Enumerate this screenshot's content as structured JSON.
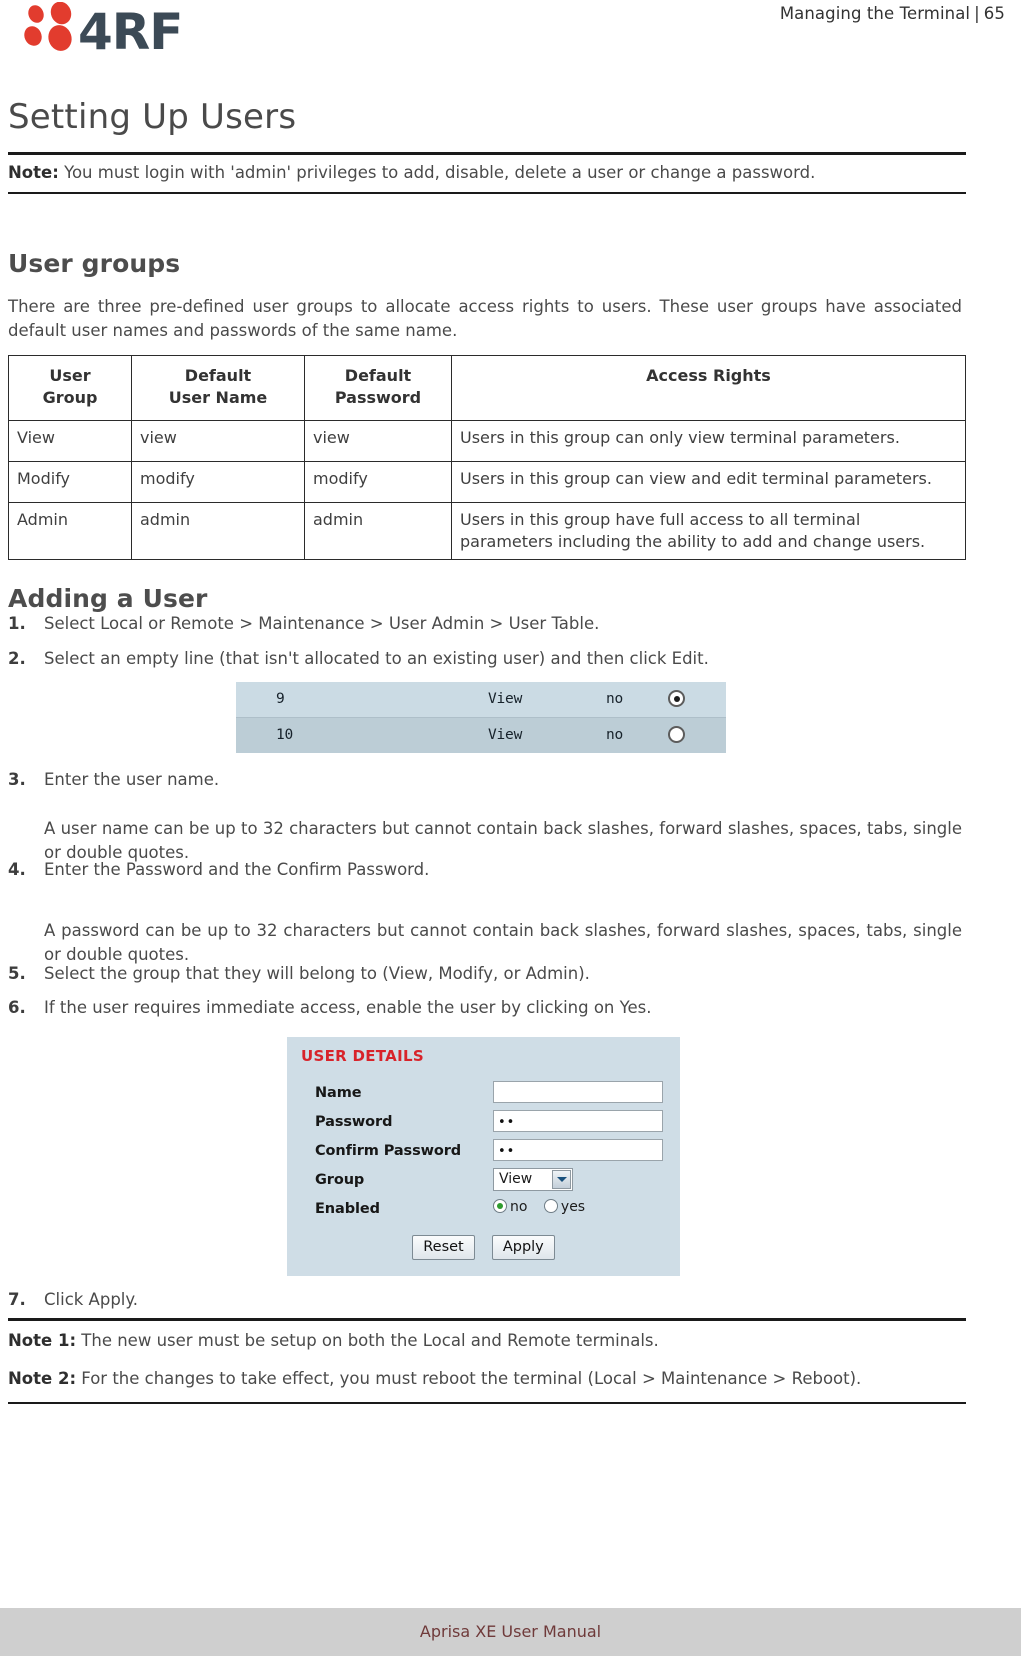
{
  "header": {
    "logo_alt": "4RF",
    "logo_text": "4RF",
    "breadcrumb_title": "Managing the Terminal",
    "breadcrumb_separator": "|",
    "page_number": "65"
  },
  "page_title": "Setting Up Users",
  "top_note": {
    "label": "Note:",
    "text": " You must login with 'admin' privileges to add, disable, delete a user or change a password."
  },
  "sections": {
    "user_groups": {
      "heading": "User groups",
      "intro": "There are three pre-defined user groups to allocate access rights to users. These user groups have associated default user names and passwords of the same name.",
      "table": {
        "headers": [
          "User\nGroup",
          "Default\nUser Name",
          "Default\nPassword",
          "Access Rights"
        ],
        "header_user_group_line1": "User",
        "header_user_group_line2": "Group",
        "header_username_line1": "Default",
        "header_username_line2": "User Name",
        "header_password_line1": "Default",
        "header_password_line2": "Password",
        "header_access_rights": "Access Rights",
        "rows": [
          {
            "group": "View",
            "username": "view",
            "password": "view",
            "access": "Users in this group can only view terminal parameters."
          },
          {
            "group": "Modify",
            "username": "modify",
            "password": "modify",
            "access": "Users in this group can view and edit terminal parameters."
          },
          {
            "group": "Admin",
            "username": "admin",
            "password": "admin",
            "access": "Users in this group have full access to all terminal parameters including the ability to add and change users."
          }
        ]
      }
    },
    "adding_a_user": {
      "heading": "Adding a User",
      "steps": [
        {
          "num": "1.",
          "text": "Select Local or Remote > Maintenance > User Admin > User Table."
        },
        {
          "num": "2.",
          "text": "Select an empty line (that isn't allocated to an existing user) and then click Edit."
        },
        {
          "num": "3.",
          "text": "Enter the user name."
        },
        {
          "num": "4.",
          "text": "Enter the Password and the Confirm Password."
        },
        {
          "num": "5.",
          "text": "Select the group that they will belong to (View, Modify, or Admin)."
        },
        {
          "num": "6.",
          "text": "If the user requires immediate access, enable the user by clicking on Yes."
        },
        {
          "num": "7.",
          "text": "Click Apply."
        }
      ],
      "sub_text_3": "A user name can be up to 32 characters but cannot contain back slashes, forward slashes, spaces, tabs, single or double quotes.",
      "sub_text_4": "A password can be up to 32 characters but cannot contain back slashes, forward slashes, spaces, tabs, single or double quotes."
    }
  },
  "screenshot_user_table": {
    "rows": [
      {
        "id": "9",
        "group": "View",
        "enabled": "no",
        "selected": true
      },
      {
        "id": "10",
        "group": "View",
        "enabled": "no",
        "selected": false
      }
    ]
  },
  "screenshot_user_details": {
    "title": "USER DETAILS",
    "title_color": "#d8232a",
    "fields": {
      "name_label": "Name",
      "name_value": "",
      "password_label": "Password",
      "password_value": "••",
      "confirm_password_label": "Confirm Password",
      "confirm_password_value": "••",
      "group_label": "Group",
      "group_value": "View",
      "enabled_label": "Enabled",
      "enabled_option_no": "no",
      "enabled_option_yes": "yes",
      "enabled_selected": "no"
    },
    "buttons": {
      "reset": "Reset",
      "apply": "Apply"
    }
  },
  "bottom_notes": [
    {
      "label": "Note 1:",
      "text": " The new user must be setup on both the Local and Remote terminals."
    },
    {
      "label": "Note 2:",
      "text": " For the changes to take effect, you must reboot the terminal (Local > Maintenance > Reboot)."
    }
  ],
  "footer": {
    "text": "Aprisa XE User Manual"
  }
}
